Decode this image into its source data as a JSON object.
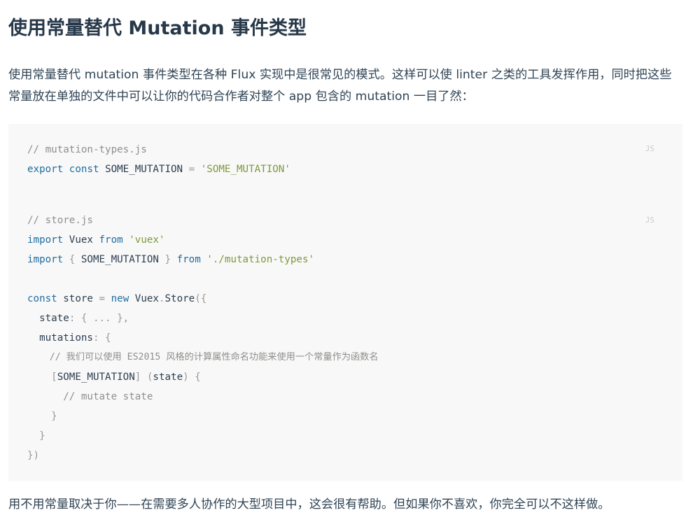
{
  "section": {
    "title": "使用常量替代 Mutation 事件类型",
    "intro": "使用常量替代 mutation 事件类型在各种 Flux 实现中是很常见的模式。这样可以使 linter 之类的工具发挥作用，同时把这些常量放在单独的文件中可以让你的代码合作者对整个 app 包含的 mutation 一目了然：",
    "outro": "用不用常量取决于你——在需要多人协作的大型项目中，这会很有帮助。但如果你不喜欢，你完全可以不这样做。"
  },
  "code_blocks": [
    {
      "lang": "JS",
      "lines": {
        "l1_comment": "// mutation-types.js",
        "l2_kw_export": "export",
        "l2_kw_const": "const",
        "l2_name": "SOME_MUTATION",
        "l2_op": "=",
        "l2_str": "'SOME_MUTATION'"
      }
    },
    {
      "lang": "JS",
      "lines": {
        "l1_comment": "// store.js",
        "l2_kw_import": "import",
        "l2_name": "Vuex",
        "l2_kw_from": "from",
        "l2_str": "'vuex'",
        "l3_kw_import": "import",
        "l3_open": "{",
        "l3_name": "SOME_MUTATION",
        "l3_close": "}",
        "l3_kw_from": "from",
        "l3_str": "'./mutation-types'",
        "l5_kw_const": "const",
        "l5_name": "store",
        "l5_op": "=",
        "l5_kw_new": "new",
        "l5_class": "Vuex",
        "l5_dot": ".",
        "l5_method": "Store",
        "l5_paren": "({",
        "l6_key": "state",
        "l6_rest": ": { ... },",
        "l7_key": "mutations",
        "l7_rest": ": {",
        "l8_comment": "// 我们可以使用 ES2015 风格的计算属性命名功能来使用一个常量作为函数名",
        "l9_open": "[",
        "l9_name": "SOME_MUTATION",
        "l9_close": "]",
        "l9_paren_open": "(",
        "l9_param": "state",
        "l9_paren_close": ") {",
        "l10_comment": "// mutate state",
        "l11_close": "}",
        "l12_close": "}",
        "l13_close": "})"
      }
    }
  ],
  "colors": {
    "title": "#273849",
    "text": "#304455",
    "code_bg": "#f8f8f8",
    "keyword": "#1f6d9f",
    "string": "#7d9a3a",
    "comment": "#8e908c"
  }
}
